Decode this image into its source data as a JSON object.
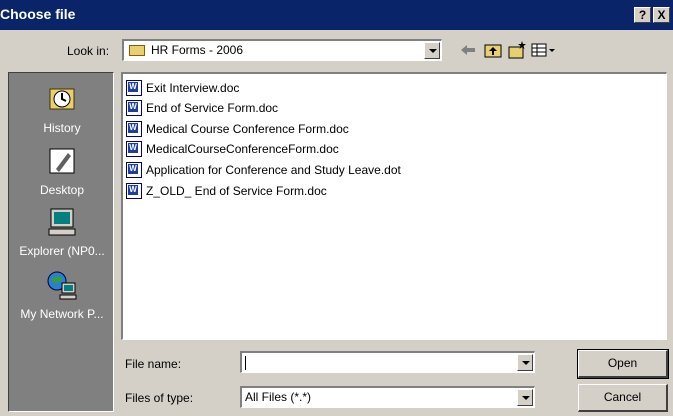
{
  "window": {
    "title": "Choose file",
    "help_label": "?",
    "close_label": "X"
  },
  "toolbar": {
    "look_in_label": "Look in:",
    "look_in_value": "HR Forms - 2006",
    "back_icon": "arrow-left-icon",
    "up_icon": "folder-up-icon",
    "new_folder_icon": "new-folder-icon",
    "views_icon": "views-menu-icon"
  },
  "places": [
    {
      "label": "History",
      "icon": "history-icon"
    },
    {
      "label": "Desktop",
      "icon": "desktop-icon"
    },
    {
      "label": "Explorer (NP0...",
      "icon": "computer-icon"
    },
    {
      "label": "My Network P...",
      "icon": "network-places-icon"
    }
  ],
  "files": [
    {
      "name": "Exit Interview.doc"
    },
    {
      "name": "End of Service Form.doc"
    },
    {
      "name": "Medical Course Conference Form.doc"
    },
    {
      "name": "MedicalCourseConferenceForm.doc"
    },
    {
      "name": "Application for Conference and Study Leave.dot"
    },
    {
      "name": "Z_OLD_ End of Service Form.doc"
    }
  ],
  "bottom": {
    "file_name_label": "File name:",
    "file_name_value": "",
    "files_of_type_label": "Files of type:",
    "files_of_type_value": "All Files (*.*)",
    "open_label": "Open",
    "cancel_label": "Cancel"
  },
  "colors": {
    "titlebar": "#0a246a",
    "face": "#d4d0c8",
    "places_bar": "#808080"
  }
}
